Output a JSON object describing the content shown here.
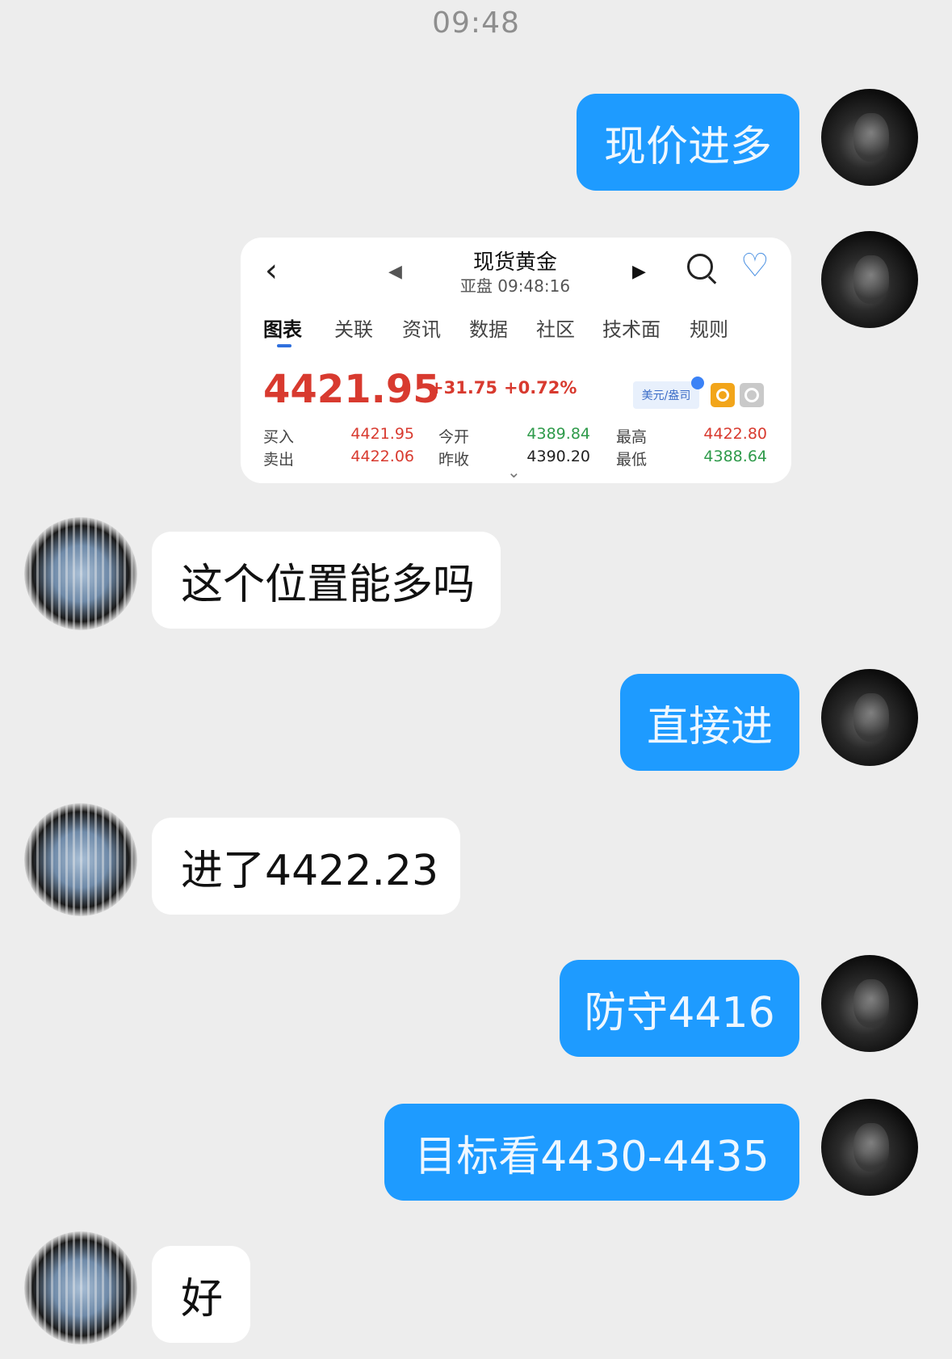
{
  "chat": {
    "timestamp": "09:48",
    "messages": [
      {
        "from": "me",
        "text": "现价进多"
      },
      {
        "from": "me",
        "type": "quote_card"
      },
      {
        "from": "other",
        "text": "这个位置能多吗"
      },
      {
        "from": "me",
        "text": "直接进"
      },
      {
        "from": "other",
        "text": "进了4422.23"
      },
      {
        "from": "me",
        "text": "防守4416"
      },
      {
        "from": "me",
        "text": "目标看4430-4435"
      },
      {
        "from": "other",
        "text": "好"
      }
    ]
  },
  "quote": {
    "back_icon": "chevron-left-icon",
    "title": "现货黄金",
    "subtitle": "亚盘 09:48:16",
    "tabs": [
      "图表",
      "关联",
      "资讯",
      "数据",
      "社区",
      "技术面",
      "规则"
    ],
    "active_tab": "图表",
    "price": "4421.95",
    "change": "+31.75",
    "change_pct": "+0.72%",
    "currency_badge": "美元/盎司",
    "rows": [
      {
        "l1": "买入",
        "v1": "4421.95",
        "l2": "今开",
        "v2": "4389.84",
        "l3": "最高",
        "v3": "4422.80"
      },
      {
        "l1": "卖出",
        "v1": "4422.06",
        "l2": "昨收",
        "v2": "4390.20",
        "l3": "最低",
        "v3": "4388.64"
      }
    ],
    "colors": {
      "up": "#d83a2f",
      "down": "#2e9a4a",
      "accent": "#2f6fdd"
    }
  },
  "icons": {
    "glyphs": {
      "back": "‹",
      "prev": "◀",
      "next": "▶",
      "heart": "♡",
      "expand": "⌄"
    }
  }
}
